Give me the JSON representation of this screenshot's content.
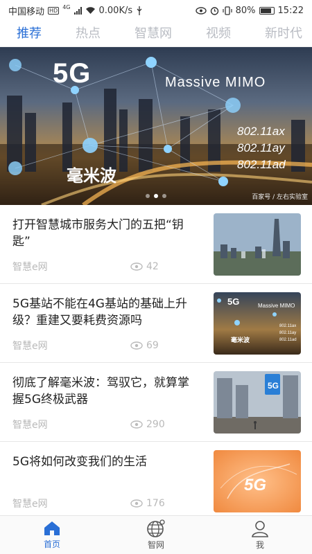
{
  "status_bar": {
    "carrier": "中国移动",
    "hd": "HD",
    "network": "4G",
    "speed": "0.00K/s",
    "battery": "80%",
    "time": "15:22"
  },
  "tabs": [
    {
      "label": "推荐",
      "active": true
    },
    {
      "label": "热点",
      "active": false
    },
    {
      "label": "智慧网",
      "active": false
    },
    {
      "label": "视频",
      "active": false
    },
    {
      "label": "新时代",
      "active": false
    }
  ],
  "banner": {
    "headline_5g": "5G",
    "mimo": "Massive MIMO",
    "wifi_standards": [
      "802.11ax",
      "802.11ay",
      "802.11ad"
    ],
    "mmwave": "毫米波",
    "credit": "百家号 / 左右实验室",
    "slide_index": 1,
    "slide_count": 3
  },
  "news": [
    {
      "title": "打开智慧城市服务大门的五把“钥匙”",
      "source": "智慧e网",
      "views": "42",
      "thumb": "city-skyline"
    },
    {
      "title": "5G基站不能在4G基站的基础上升级？重建又要耗费资源吗",
      "source": "智慧e网",
      "views": "69",
      "thumb": "5g-mimo"
    },
    {
      "title": "彻底了解毫米波：驾驭它，就算掌握5G终极武器",
      "source": "智慧e网",
      "views": "290",
      "thumb": "5g-street"
    },
    {
      "title": "5G将如何改变我们的生活",
      "source": "智慧e网",
      "views": "176",
      "thumb": "5g-orange"
    }
  ],
  "bottom_nav": [
    {
      "label": "首页",
      "icon": "home-icon",
      "active": true
    },
    {
      "label": "智网",
      "icon": "globe-icon",
      "active": false
    },
    {
      "label": "我",
      "icon": "user-icon",
      "active": false
    }
  ],
  "colors": {
    "accent": "#2a6fd6",
    "muted": "#b9bcc3"
  }
}
